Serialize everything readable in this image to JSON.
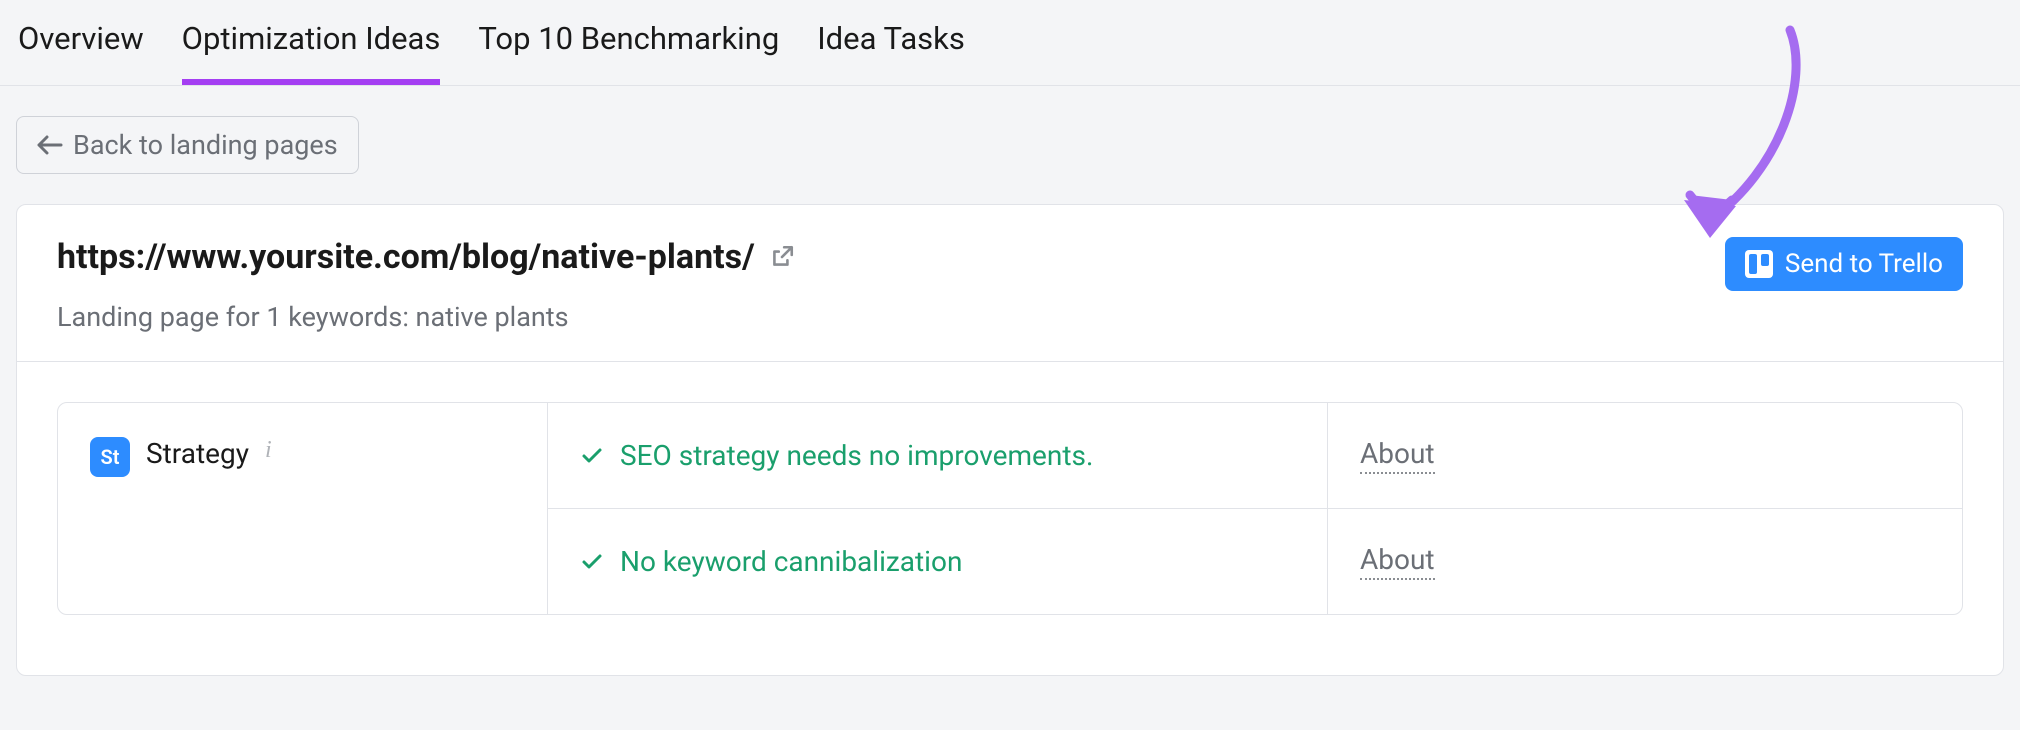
{
  "tabs": [
    {
      "label": "Overview"
    },
    {
      "label": "Optimization Ideas"
    },
    {
      "label": "Top 10 Benchmarking"
    },
    {
      "label": "Idea Tasks"
    }
  ],
  "active_tab_index": 1,
  "back_button": {
    "label": "Back to landing pages"
  },
  "page": {
    "url": "https://www.yoursite.com/blog/native-plants/",
    "subtext": "Landing page for 1 keywords: native plants"
  },
  "trello": {
    "label": "Send to Trello"
  },
  "strategy": {
    "badge": "St",
    "label": "Strategy",
    "rows": [
      {
        "text": "SEO strategy needs no improvements.",
        "about": "About"
      },
      {
        "text": "No keyword cannibalization",
        "about": "About"
      }
    ]
  }
}
